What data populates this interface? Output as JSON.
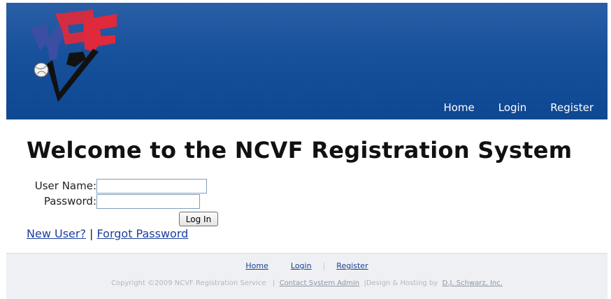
{
  "header": {
    "logo_alt": "NCVF",
    "nav": {
      "home": "Home",
      "login": "Login",
      "register": "Register"
    }
  },
  "main": {
    "title": "Welcome to the NCVF Registration System",
    "username_label": "User Name:",
    "username_value": "",
    "password_label": "Password:",
    "password_value": "",
    "login_button": "Log In",
    "new_user_link": "New User?",
    "separator": "|",
    "forgot_password_link": "Forgot Password"
  },
  "footer": {
    "nav": {
      "home": "Home",
      "login": "Login",
      "separator": "|",
      "register": "Register"
    },
    "copyright": "Copyright ©2009 NCVF Registration Service",
    "sep1": "|",
    "contact_link": "Contact System Admin",
    "design_text": "|Design & Hosting by",
    "designer_link": "D.J. Schwarz, Inc."
  },
  "colors": {
    "header_blue": "#17509b",
    "link_blue": "#1c3f9e",
    "logo_red": "#e0293a",
    "logo_blue": "#3a4fa3"
  }
}
